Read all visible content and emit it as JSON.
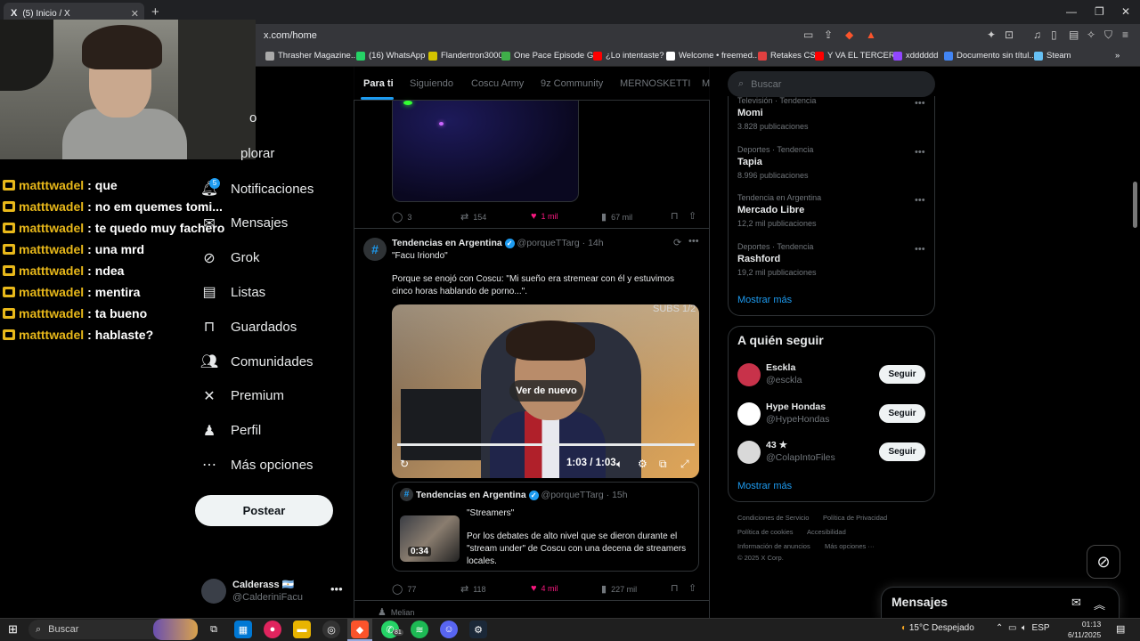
{
  "browser": {
    "tab_title": "(5) Inicio / X",
    "tab_icon": "X",
    "url": "x.com/home",
    "bookmarks": [
      {
        "label": "Thrasher Magazine...",
        "color": "#aaaaaa"
      },
      {
        "label": "(16) WhatsApp",
        "color": "#25d366"
      },
      {
        "label": "Flandertron3000",
        "color": "#d4c400"
      },
      {
        "label": "One Pace Episode G...",
        "color": "#3fae49"
      },
      {
        "label": "¿Lo intentaste?",
        "color": "#ff0000"
      },
      {
        "label": "Welcome • freemed...",
        "color": "#ffffff"
      },
      {
        "label": "Retakes CS",
        "color": "#e04040"
      },
      {
        "label": "Y VA EL TERCERO",
        "color": "#ff0000"
      },
      {
        "label": "xdddddd",
        "color": "#9146ff"
      },
      {
        "label": "Documento sin títul...",
        "color": "#4285f4"
      },
      {
        "label": "Steam",
        "color": "#66c0f4"
      }
    ]
  },
  "chat": [
    {
      "user": "matttwadel",
      "msg": "que"
    },
    {
      "user": "matttwadel",
      "msg": "no em quemes tomi..."
    },
    {
      "user": "matttwadel",
      "msg": "te quedo muy fachero"
    },
    {
      "user": "matttwadel",
      "msg": "una mrd"
    },
    {
      "user": "matttwadel",
      "msg": "ndea"
    },
    {
      "user": "matttwadel",
      "msg": "mentira"
    },
    {
      "user": "matttwadel",
      "msg": "ta bueno"
    },
    {
      "user": "matttwadel",
      "msg": "hablaste?"
    }
  ],
  "nav": {
    "partial_home": "o",
    "partial_explore": "plorar",
    "items": [
      "Notificaciones",
      "Mensajes",
      "Grok",
      "Listas",
      "Guardados",
      "Comunidades",
      "Premium",
      "Perfil",
      "Más opciones"
    ],
    "notif_badge": "5",
    "post_label": "Postear",
    "profile_name": "Calderass 🇦🇷",
    "profile_handle": "@CalderiniFacu",
    "profile_more": "•••"
  },
  "feed": {
    "tabs": [
      "Para ti",
      "Siguiendo",
      "Coscu Army",
      "9z Community",
      "MERNOSKETTI",
      "M"
    ],
    "prev_actions": {
      "replies": "3",
      "reposts": "154",
      "likes": "1 mil",
      "views": "67 mil"
    },
    "tweet": {
      "author": "Tendencias en Argentina",
      "handle": "@porqueTTarg",
      "time": "· 14h",
      "title": "\"Facu Iriondo\"",
      "body": "Porque se enojó con Coscu: \"Mi sueño era stremear con él y estuvimos cinco horas hablando de porno...\".",
      "subs": "SUBS 1/2",
      "ver_nuevo": "Ver de nuevo",
      "video_time": "1:03 / 1:03",
      "quote": {
        "author": "Tendencias en Argentina",
        "handle": "@porqueTTarg",
        "time": "· 15h",
        "title": "\"Streamers\"",
        "body": "Por los debates de alto nivel que se dieron durante el \"stream under\" de Coscu con una decena de streamers locales.",
        "duration": "0:34"
      },
      "actions": {
        "replies": "77",
        "reposts": "118",
        "likes": "4 mil",
        "views": "227 mil"
      }
    },
    "next_author": "Melian"
  },
  "sidebar": {
    "search_placeholder": "Buscar",
    "trends": [
      {
        "category": "Televisión · Tendencia",
        "name": "Momi",
        "count": "3.828 publicaciones"
      },
      {
        "category": "Deportes · Tendencia",
        "name": "Tapia",
        "count": "8.996 publicaciones"
      },
      {
        "category": "Tendencia en Argentina",
        "name": "Mercado Libre",
        "count": "12,2 mil publicaciones"
      },
      {
        "category": "Deportes · Tendencia",
        "name": "Rashford",
        "count": "19,2 mil publicaciones"
      }
    ],
    "show_more": "Mostrar más",
    "follow_title": "A quién seguir",
    "follow": [
      {
        "name": "Esckla",
        "handle": "@esckla",
        "button": "Seguir",
        "avatar_color": "#c8324a"
      },
      {
        "name": "Hype Hondas",
        "handle": "@HypeHondas",
        "button": "Seguir",
        "avatar_color": "#ffffff"
      },
      {
        "name": "43 ★",
        "handle": "@ColapIntoFiles",
        "button": "Seguir",
        "avatar_color": "#d9d9d9"
      }
    ],
    "footer": [
      "Condiciones de Servicio",
      "Política de Privacidad",
      "Política de cookies",
      "Accesibilidad",
      "Información de anuncios",
      "Más opciones ···",
      "© 2025 X Corp."
    ],
    "messages_title": "Mensajes"
  },
  "taskbar": {
    "search_placeholder": "Buscar",
    "weather": "15°C  Despejado",
    "lang": "ESP",
    "time": "01:13",
    "date": "6/11/2025",
    "discord_badge": "81"
  }
}
